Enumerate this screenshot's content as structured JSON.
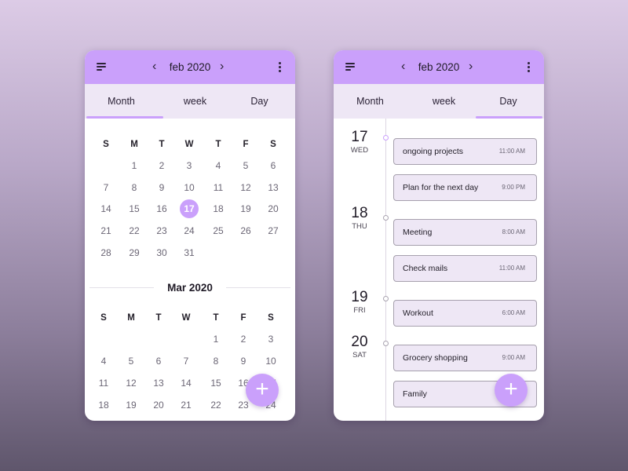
{
  "left_screen": {
    "header": {
      "title": "feb 2020",
      "prev_icon": "chevron-left-icon",
      "next_icon": "chevron-right-icon",
      "menu_icon": "menu-icon",
      "more_icon": "more-vertical-icon"
    },
    "tabs": [
      {
        "label": "Month",
        "active": true
      },
      {
        "label": "week",
        "active": false
      },
      {
        "label": "Day",
        "active": false
      }
    ],
    "feb": {
      "weekdays": [
        "S",
        "M",
        "T",
        "W",
        "T",
        "F",
        "S"
      ],
      "weeks": [
        [
          "",
          "1",
          "2",
          "3",
          "4",
          "5",
          "6"
        ],
        [
          "7",
          "8",
          "9",
          "10",
          "11",
          "12",
          "13"
        ],
        [
          "14",
          "15",
          "16",
          "17",
          "18",
          "19",
          "20"
        ],
        [
          "21",
          "22",
          "23",
          "24",
          "25",
          "26",
          "27"
        ],
        [
          "28",
          "29",
          "30",
          "31",
          "",
          "",
          ""
        ]
      ],
      "selected_day": "17"
    },
    "mar": {
      "title": "Mar 2020",
      "weekdays": [
        "S",
        "M",
        "T",
        "W",
        "T",
        "F",
        "S"
      ],
      "weeks": [
        [
          "",
          "",
          "",
          "",
          "1",
          "2",
          "3"
        ],
        [
          "4",
          "5",
          "6",
          "7",
          "8",
          "9",
          "10"
        ],
        [
          "11",
          "12",
          "13",
          "14",
          "15",
          "16",
          "17"
        ],
        [
          "18",
          "19",
          "20",
          "21",
          "22",
          "23",
          "24"
        ]
      ]
    },
    "fab_label": "+"
  },
  "right_screen": {
    "header": {
      "title": "feb 2020",
      "prev_icon": "chevron-left-icon",
      "next_icon": "chevron-right-icon",
      "menu_icon": "menu-icon",
      "more_icon": "more-vertical-icon"
    },
    "tabs": [
      {
        "label": "Month",
        "active": false
      },
      {
        "label": "week",
        "active": false
      },
      {
        "label": "Day",
        "active": true
      }
    ],
    "days": [
      {
        "num": "17",
        "name": "WED",
        "events": [
          {
            "title": "ongoing projects",
            "time": "11:00 AM"
          },
          {
            "title": "Plan for the next day",
            "time": "9:00 PM"
          }
        ]
      },
      {
        "num": "18",
        "name": "THU",
        "events": [
          {
            "title": "Meeting",
            "time": "8:00 AM"
          },
          {
            "title": "Check mails",
            "time": "11:00 AM"
          }
        ]
      },
      {
        "num": "19",
        "name": "FRI",
        "events": [
          {
            "title": "Workout",
            "time": "6:00 AM"
          }
        ]
      },
      {
        "num": "20",
        "name": "SAT",
        "events": [
          {
            "title": "Grocery shopping",
            "time": "9:00 AM"
          },
          {
            "title": "Family",
            "time": ""
          }
        ]
      }
    ],
    "fab_label": "+"
  },
  "colors": {
    "accent": "#caa0fb",
    "tab_background": "#eee7f5",
    "event_background": "#eee7f5"
  }
}
